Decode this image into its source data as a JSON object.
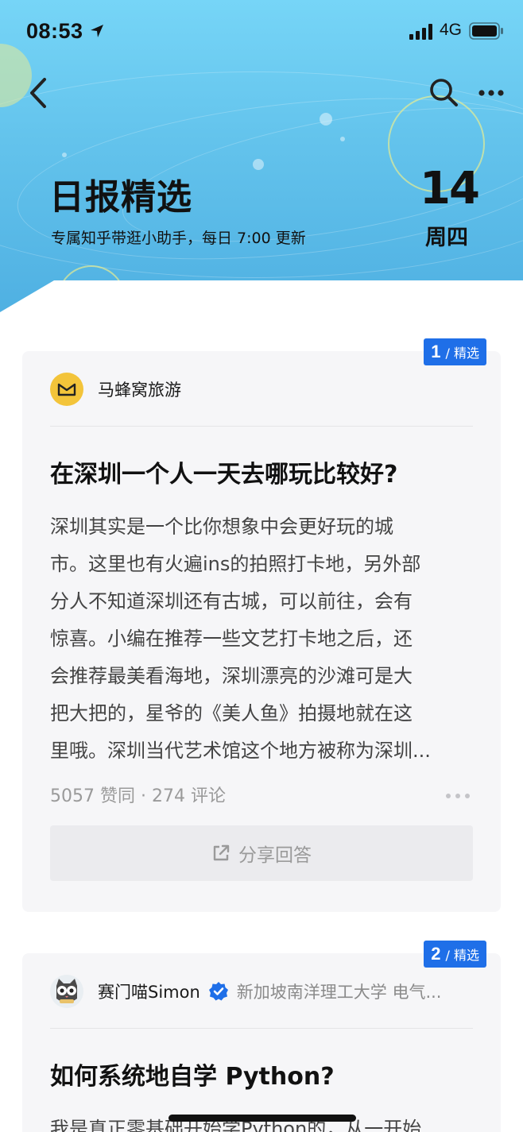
{
  "status_bar": {
    "time": "08:53",
    "network": "4G"
  },
  "header": {
    "title": "日报精选",
    "subtitle": "专属知乎带逛小助手，每日 7:00 更新",
    "day": "14",
    "weekday": "周四"
  },
  "colors": {
    "accent": "#1f6fe8",
    "hero_top": "#76d5f7",
    "hero_bottom": "#4fb0e2"
  },
  "cards": [
    {
      "badge_num": "1",
      "badge_label": "/ 精选",
      "author": "马蜂窝旅游",
      "author_desc": "",
      "title": "在深圳一个人一天去哪玩比较好?",
      "body_lines": [
        "深圳其实是一个比你想象中会更好玩的城",
        "市。这里也有火遍ins的拍照打卡地，另外部",
        "分人不知道深圳还有古城，可以前往，会有",
        "惊喜。小编在推荐一些文艺打卡地之后，还",
        "会推荐最美看海地，深圳漂亮的沙滩可是大",
        "把大把的，星爷的《美人鱼》拍摄地就在这",
        "里哦。深圳当代艺术馆这个地方被称为深圳..."
      ],
      "stats": "5057 赞同 · 274 评论",
      "share_label": "分享回答"
    },
    {
      "badge_num": "2",
      "badge_label": "/ 精选",
      "author": "赛门喵Simon",
      "author_desc": "新加坡南洋理工大学 电气...",
      "title": "如何系统地自学 Python?",
      "body_lines": [
        "我是真正零基础开始学Python的，从一开始"
      ]
    }
  ],
  "icons": {
    "back": "chevron-left-icon",
    "search": "search-icon",
    "more": "more-horizontal-icon",
    "share": "share-external-icon",
    "verified": "verified-check-icon"
  }
}
